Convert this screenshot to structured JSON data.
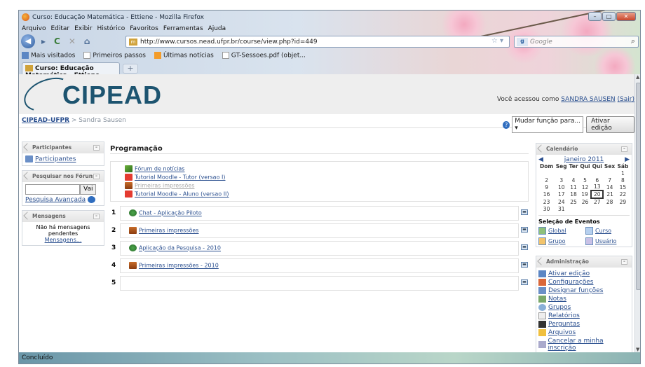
{
  "window": {
    "title": "Curso: Educação Matemática - Ettiene - Mozilla Firefox"
  },
  "menu": [
    "Arquivo",
    "Editar",
    "Exibir",
    "Histórico",
    "Favoritos",
    "Ferramentas",
    "Ajuda"
  ],
  "nav": {
    "url": "http://www.cursos.nead.ufpr.br/course/view.php?id=449",
    "search_placeholder": "Google"
  },
  "bookmarks": [
    "Mais visitados",
    "Primeiros passos",
    "Últimas notícias",
    "GT-Sessoes.pdf (objet..."
  ],
  "tab": {
    "label": "Curso: Educação Matemática - Ettiene"
  },
  "header": {
    "logo": "CIPEAD",
    "login_prefix": "Você acessou como",
    "user": "SANDRA SAUSEN",
    "logout": "(Sair)"
  },
  "breadcrumb": {
    "home": "CIPEAD-UFPR",
    "sep": " > ",
    "current": "Sandra Sausen"
  },
  "role": {
    "select": "Mudar função para...",
    "edit_button": "Ativar edição"
  },
  "left": {
    "participants": {
      "title": "Participantes",
      "link": "Participantes"
    },
    "search": {
      "title": "Pesquisar nos Fóruns",
      "button": "Vai",
      "advanced": "Pesquisa Avançada"
    },
    "messages": {
      "title": "Mensagens",
      "text": "Não há mensagens pendentes",
      "link": "Mensagens..."
    }
  },
  "main": {
    "title": "Programação",
    "section0": [
      {
        "label": "Fórum de notícias",
        "icon": "forum-icon",
        "hidden": false
      },
      {
        "label": "Tutorial Moodle - Tutor (versao I)",
        "icon": "pdf-icon",
        "hidden": false
      },
      {
        "label": "Primeiras impressões",
        "icon": "quiz-icon",
        "hidden": true
      },
      {
        "label": "Tutorial Moodle - Aluno (versao II)",
        "icon": "pdf-icon",
        "hidden": false
      }
    ],
    "sections": [
      {
        "num": "1",
        "label": "Chat - Aplicação Piloto",
        "icon": "chat-icon"
      },
      {
        "num": "2",
        "label": "Primeiras impressões",
        "icon": "quiz-icon"
      },
      {
        "num": "3",
        "label": "Aplicação da Pesquisa - 2010",
        "icon": "chat-icon"
      },
      {
        "num": "4",
        "label": "Primeiras impressões - 2010",
        "icon": "quiz-icon"
      },
      {
        "num": "5",
        "label": "",
        "icon": ""
      }
    ]
  },
  "calendar": {
    "title": "Calendário",
    "month": "janeiro 2011",
    "days": [
      "Dom",
      "Seg",
      "Ter",
      "Qui",
      "Qui",
      "Sex",
      "Sáb"
    ],
    "weeks": [
      [
        "",
        "",
        "",
        "",
        "",
        "",
        "1"
      ],
      [
        "2",
        "3",
        "4",
        "5",
        "6",
        "7",
        "8"
      ],
      [
        "9",
        "10",
        "11",
        "12",
        "13",
        "14",
        "15"
      ],
      [
        "16",
        "17",
        "18",
        "19",
        "20",
        "21",
        "22"
      ],
      [
        "23",
        "24",
        "25",
        "26",
        "27",
        "28",
        "29"
      ],
      [
        "30",
        "31",
        "",
        "",
        "",
        "",
        ""
      ]
    ],
    "today": "20",
    "events_title": "Seleção de Eventos",
    "events": [
      "Global",
      "Curso",
      "Grupo",
      "Usuário"
    ]
  },
  "admin": {
    "title": "Administração",
    "items": [
      "Ativar edição",
      "Configurações",
      "Designar funções",
      "Notas",
      "Grupos",
      "Relatórios",
      "Perguntas",
      "Arquivos",
      "Cancelar a minha inscrição"
    ]
  },
  "status": "Concluído"
}
